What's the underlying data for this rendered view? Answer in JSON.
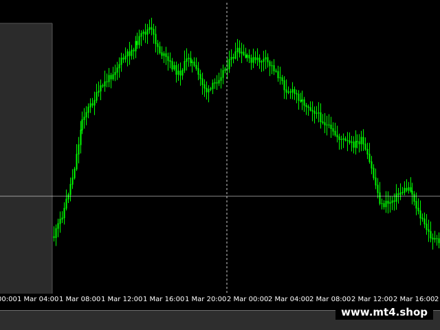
{
  "chart_data": {
    "type": "candlestick",
    "colors": {
      "background": "#000000",
      "candle": "#00ff00",
      "crosshair": "#ffffff",
      "shaded_region": "#2b2b2b"
    },
    "x_ticks": [
      "00:00",
      "1 Mar 04:00",
      "1 Mar 08:00",
      "1 Mar 12:00",
      "1 Mar 16:00",
      "1 Mar 20:00",
      "2 Mar 00:00",
      "2 Mar 04:00",
      "2 Mar 08:00",
      "2 Mar 12:00",
      "2 Mar 16:00",
      "2"
    ],
    "price_path": [
      [
        "1 Mar 04:00",
        0.11
      ],
      [
        "1 Mar 05:00",
        0.22
      ],
      [
        "1 Mar 06:00",
        0.38
      ],
      [
        "1 Mar 07:00",
        0.62
      ],
      [
        "1 Mar 08:00",
        0.68
      ],
      [
        "1 Mar 09:00",
        0.75
      ],
      [
        "1 Mar 10:00",
        0.8
      ],
      [
        "1 Mar 11:00",
        0.86
      ],
      [
        "1 Mar 12:00",
        0.9
      ],
      [
        "1 Mar 12:30",
        0.96
      ],
      [
        "1 Mar 13:00",
        1.0
      ],
      [
        "1 Mar 14:00",
        0.9
      ],
      [
        "1 Mar 15:00",
        0.85
      ],
      [
        "1 Mar 16:00",
        0.8
      ],
      [
        "1 Mar 17:00",
        0.88
      ],
      [
        "1 Mar 18:00",
        0.8
      ],
      [
        "1 Mar 19:00",
        0.72
      ],
      [
        "1 Mar 20:00",
        0.78
      ],
      [
        "1 Mar 21:00",
        0.84
      ],
      [
        "1 Mar 22:00",
        0.9
      ],
      [
        "1 Mar 23:00",
        0.87
      ],
      [
        "2 Mar 00:00",
        0.86
      ],
      [
        "2 Mar 01:00",
        0.86
      ],
      [
        "2 Mar 02:00",
        0.82
      ],
      [
        "2 Mar 03:00",
        0.74
      ],
      [
        "2 Mar 04:00",
        0.72
      ],
      [
        "2 Mar 05:00",
        0.68
      ],
      [
        "2 Mar 06:00",
        0.65
      ],
      [
        "2 Mar 07:00",
        0.6
      ],
      [
        "2 Mar 08:00",
        0.55
      ],
      [
        "2 Mar 09:00",
        0.52
      ],
      [
        "2 Mar 10:00",
        0.5
      ],
      [
        "2 Mar 11:00",
        0.52
      ],
      [
        "2 Mar 12:00",
        0.4
      ],
      [
        "2 Mar 13:00",
        0.24
      ],
      [
        "2 Mar 14:00",
        0.26
      ],
      [
        "2 Mar 15:00",
        0.3
      ],
      [
        "2 Mar 16:00",
        0.32
      ],
      [
        "2 Mar 17:00",
        0.2
      ],
      [
        "2 Mar 18:00",
        0.12
      ],
      [
        "2 Mar 18:30",
        0.08
      ]
    ]
  },
  "watermark": {
    "text": "www.mt4.shop"
  }
}
